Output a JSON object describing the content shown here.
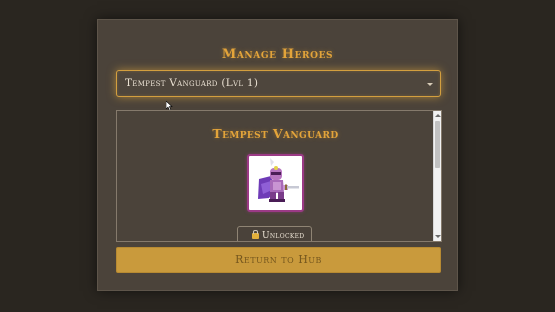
{
  "colors": {
    "background": "#2a2620",
    "panel": "#4b433a",
    "accent_gold": "#e3a43a",
    "button_gold": "#c99a3c",
    "button_text": "#75571e",
    "portrait_border": "#9b3a86"
  },
  "panel": {
    "title": "Manage Heroes"
  },
  "hero_select": {
    "selected": "Tempest Vanguard (Lvl 1)",
    "caret_icon": "chevron-down-icon"
  },
  "hero_detail": {
    "name": "Tempest Vanguard",
    "portrait_icon": "purple-armored-knight-with-sword",
    "status_icon": "unlocked-padlock-icon",
    "status_label": "Unlocked"
  },
  "actions": {
    "return_label": "Return to Hub"
  }
}
